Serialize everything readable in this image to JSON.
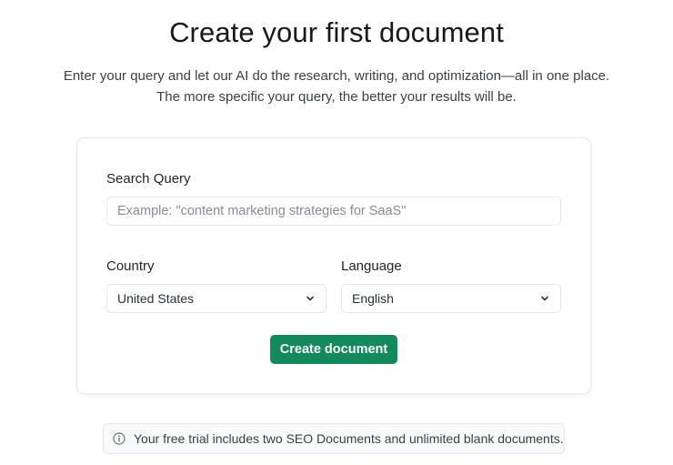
{
  "header": {
    "title": "Create your first document",
    "subtitle_line1": "Enter your query and let our AI do the research, writing, and optimization—all in one place.",
    "subtitle_line2": "The more specific your query, the better your results will be."
  },
  "form": {
    "search_query_label": "Search Query",
    "search_query_placeholder": "Example: \"content marketing strategies for SaaS\"",
    "search_query_value": "",
    "country_label": "Country",
    "country_value": "United States",
    "language_label": "Language",
    "language_value": "English",
    "submit_label": "Create document"
  },
  "notice": {
    "icon": "info-icon",
    "text": "Your free trial includes two SEO Documents and unlimited blank documents."
  },
  "colors": {
    "accent": "#128a5c",
    "border": "#e3e6ea",
    "notice_bg": "#f8f9fa"
  }
}
